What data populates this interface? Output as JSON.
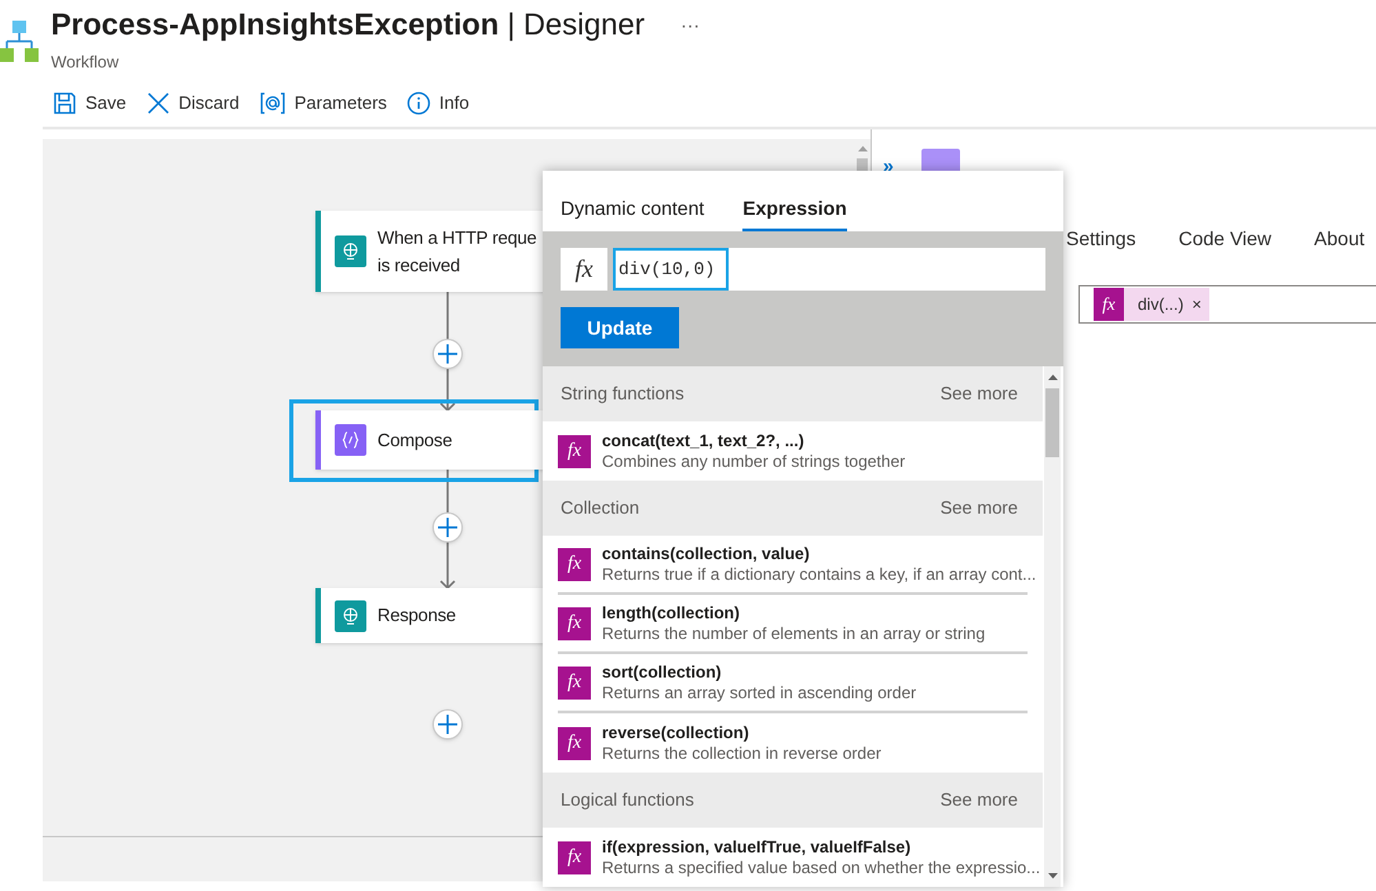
{
  "header": {
    "title": "Process-AppInsightsException",
    "title_suffix": "| Designer",
    "more": "···",
    "subtitle": "Workflow"
  },
  "toolbar": [
    {
      "kind": "save",
      "label": "Save"
    },
    {
      "kind": "discard",
      "label": "Discard"
    },
    {
      "kind": "parameters",
      "label": "Parameters"
    },
    {
      "kind": "info",
      "label": "Info"
    }
  ],
  "canvas": {
    "nodes": [
      {
        "kind": "trigger",
        "lines": [
          "When a HTTP reque",
          "is received"
        ],
        "color": "#0f9a9e",
        "selected": false
      },
      {
        "kind": "compose",
        "lines": [
          "Compose"
        ],
        "color": "#8661f5",
        "selected": true
      },
      {
        "kind": "response",
        "lines": [
          "Response"
        ],
        "color": "#0f9a9e",
        "selected": false
      }
    ]
  },
  "details": {
    "expand": "»",
    "tabs": [
      {
        "label": "Settings",
        "selected": false
      },
      {
        "label": "Code View",
        "selected": false
      },
      {
        "label": "About",
        "selected": false
      }
    ],
    "token": {
      "icon": "fx",
      "label": "div(...)",
      "remove": "×"
    }
  },
  "popup": {
    "tabs": [
      {
        "label": "Dynamic content",
        "selected": false
      },
      {
        "label": "Expression",
        "selected": true
      }
    ],
    "expression": {
      "icon": "fx",
      "value": "div(10,0)"
    },
    "button": "Update",
    "sections": [
      {
        "title": "String functions",
        "see_more": "See more",
        "items": [
          {
            "icon": "fx",
            "name": "concat(text_1, text_2?, ...)",
            "description": "Combines any number of strings together"
          }
        ]
      },
      {
        "title": "Collection",
        "see_more": "See more",
        "items": [
          {
            "icon": "fx",
            "name": "contains(collection, value)",
            "description": "Returns true if a dictionary contains a key, if an array cont..."
          },
          {
            "icon": "fx",
            "name": "length(collection)",
            "description": "Returns the number of elements in an array or string"
          },
          {
            "icon": "fx",
            "name": "sort(collection)",
            "description": "Returns an array sorted in ascending order"
          },
          {
            "icon": "fx",
            "name": "reverse(collection)",
            "description": "Returns the collection in reverse order"
          }
        ]
      },
      {
        "title": "Logical functions",
        "see_more": "See more",
        "items": [
          {
            "icon": "fx",
            "name": "if(expression, valueIfTrue, valueIfFalse)",
            "description": "Returns a specified value based on whether the expressio..."
          }
        ]
      }
    ]
  }
}
